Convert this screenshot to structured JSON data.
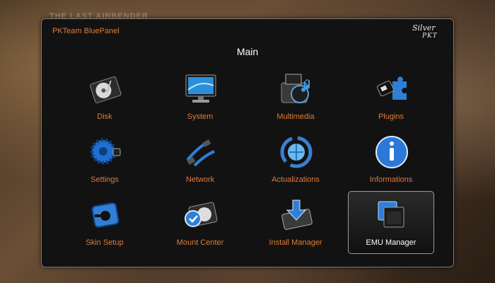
{
  "background": {
    "watermark": "THE LAST AIRBENDER"
  },
  "panel": {
    "title": "PKTeam BluePanel",
    "brand_line1": "Silver",
    "brand_line2": "PKT",
    "heading": "Main",
    "accent_color": "#e07a3a",
    "selected_index": 11,
    "items": [
      {
        "label": "Disk",
        "icon": "disk-icon"
      },
      {
        "label": "System",
        "icon": "monitor-icon"
      },
      {
        "label": "Multimedia",
        "icon": "multimedia-icon"
      },
      {
        "label": "Plugins",
        "icon": "plugin-icon"
      },
      {
        "label": "Settings",
        "icon": "gear-icon"
      },
      {
        "label": "Network",
        "icon": "network-cable-icon"
      },
      {
        "label": "Actualizations",
        "icon": "refresh-globe-icon"
      },
      {
        "label": "Informations",
        "icon": "info-icon"
      },
      {
        "label": "Skin Setup",
        "icon": "skin-setup-icon"
      },
      {
        "label": "Mount Center",
        "icon": "mount-disk-icon"
      },
      {
        "label": "Install Manager",
        "icon": "install-drive-icon"
      },
      {
        "label": "EMU Manager",
        "icon": "windows-icon"
      }
    ]
  }
}
